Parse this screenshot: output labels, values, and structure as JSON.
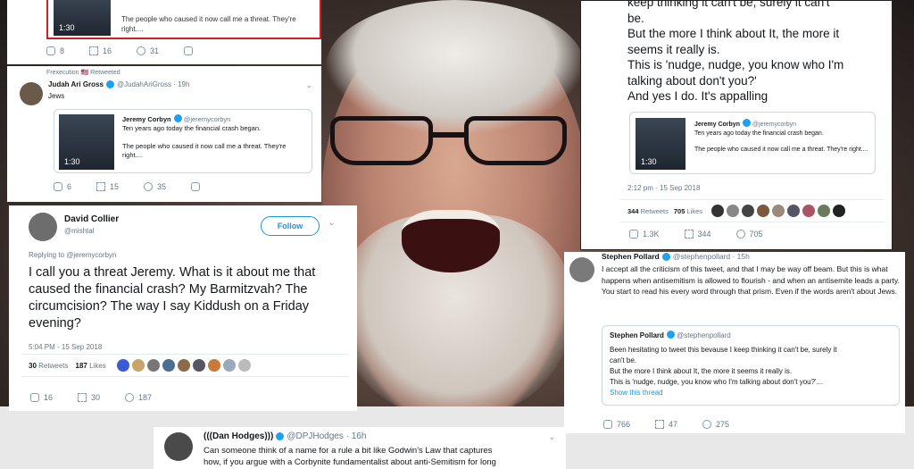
{
  "quoted": {
    "name": "Jeremy Corbyn",
    "handle": "@jeremycorbyn",
    "line1": "Ten years ago today the financial crash began.",
    "line2": "The people who caused it now call me a threat. They're right....",
    "duration": "1:30"
  },
  "tweet_top": {
    "stats": [
      "8",
      "16",
      "31"
    ]
  },
  "tweet_gross": {
    "retweet_note": "Frexecution 🇺🇸 Retweeted",
    "name": "Judah Ari Gross",
    "handle": "@JudahAriGross · 19h",
    "text": "Jews",
    "stats": [
      "6",
      "15",
      "35"
    ]
  },
  "tweet_collier": {
    "name": "David Collier",
    "handle": "@mishtal",
    "follow_label": "Follow",
    "reply_to": "Replying to @jeremycorbyn",
    "text": "I call you a threat Jeremy. What is it about me that caused the financial crash? My Barmitzvah? The circumcision? The way I say Kiddush on a Friday evening?",
    "time": "5:04 PM - 15 Sep 2018",
    "retweets": "30",
    "retweets_label": "Retweets",
    "likes": "187",
    "likes_label": "Likes",
    "stats": [
      "16",
      "30",
      "187"
    ]
  },
  "tweet_pollard_top": {
    "text_lines": [
      "keep thinking it can't be, surely it can't",
      "be.",
      "But the more I think about It, the more it",
      "seems it really is.",
      "This is 'nudge, nudge, you know who I'm",
      "talking about don't you?'",
      "And yes I do. It's appalling"
    ],
    "time": "2:12 pm - 15 Sep 2018",
    "retweets": "344",
    "retweets_label": "Retweets",
    "likes": "705",
    "likes_label": "Likes",
    "stats": [
      "1.3K",
      "344",
      "705"
    ]
  },
  "tweet_pollard_bottom": {
    "name": "Stephen Pollard",
    "handle": "@stephenpollard · 15h",
    "text": "I accept all the criticism of this tweet, and that I may be way off beam. But this is what happens when antisemitism is allowed to flourish - and when an antisemite leads a party. You start to read his every word through that prism. Even if the words aren't about Jews.",
    "quote_name": "Stephen Pollard",
    "quote_handle": "@stephenpollard",
    "quote_lines": [
      "Been hesitating to tweet this bevause I keep thinking it can't be, surely it",
      "can't be.",
      "But the more I think about It, the more it seems it really is.",
      "This is 'nudge, nudge, you know who I'm talking about don't you?'..."
    ],
    "show_thread": "Show this thread",
    "stats": [
      "766",
      "47",
      "275"
    ]
  },
  "tweet_hodges": {
    "name": "(((Dan Hodges)))",
    "handle": "@DPJHodges · 16h",
    "text_lines": [
      "Can someone think of a name for a rule a bit like Godwin's Law that captures",
      "how, if you argue with a Corbynite fundamentalist about anti-Semitism for long"
    ]
  },
  "colors": {
    "twitter_blue": "#1b95e0",
    "muted": "#657786",
    "highlight_border": "#d0201d"
  }
}
